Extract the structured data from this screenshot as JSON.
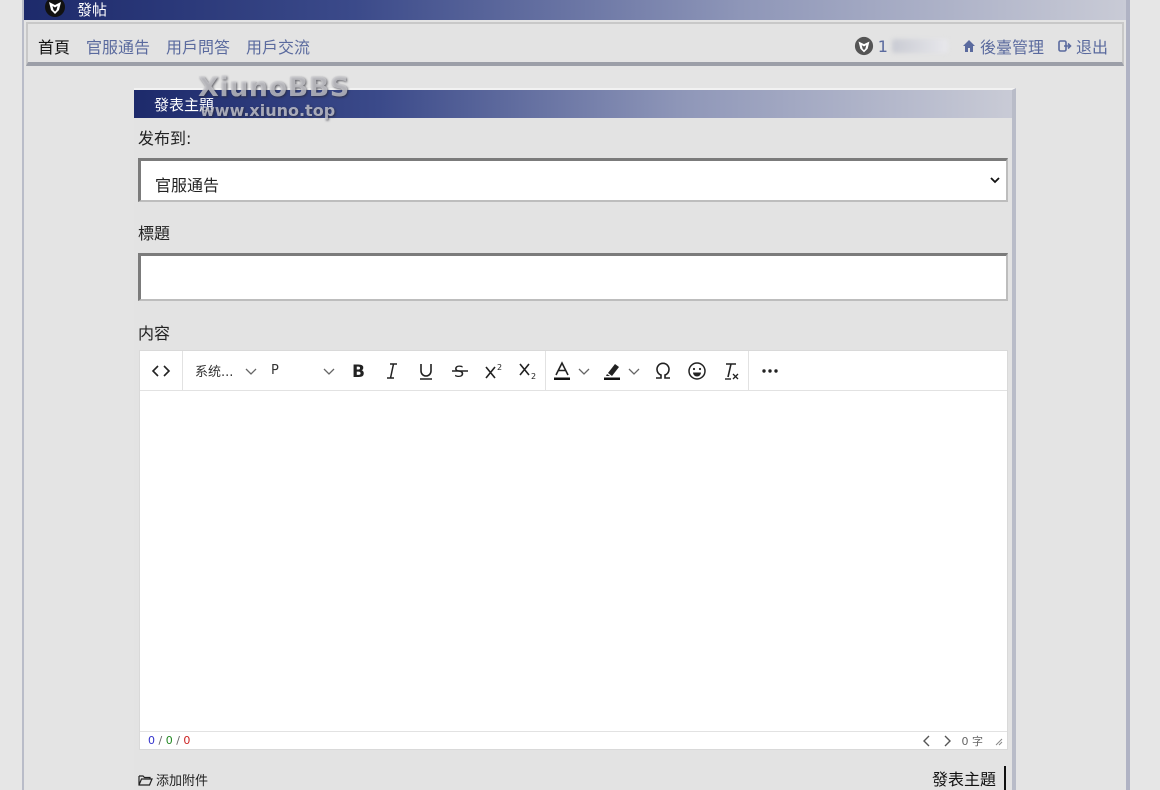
{
  "window": {
    "title": "發帖"
  },
  "nav": {
    "links": [
      "首頁",
      "官服通告",
      "用戶問答",
      "用戶交流"
    ],
    "user_label": "1",
    "admin_label": "後臺管理",
    "logout_label": "退出"
  },
  "panel": {
    "title": "發表主題",
    "watermark_line1": "XiunoBBS",
    "watermark_line2": "www.xiuno.top"
  },
  "form": {
    "publish_to_label": "发布到:",
    "publish_to_value": "官服通告",
    "title_label": "標題",
    "title_value": "",
    "content_label": "内容"
  },
  "editor": {
    "font_family": "系统...",
    "block_format": "P",
    "counts": {
      "a": "0",
      "b": "0",
      "c": "0"
    },
    "word_count": "0 字",
    "toolbar_icons": [
      "code-view-icon",
      "bold-icon",
      "italic-icon",
      "underline-icon",
      "strikethrough-icon",
      "superscript-icon",
      "subscript-icon",
      "font-color-icon",
      "highlight-icon",
      "special-char-icon",
      "emoji-icon",
      "clear-format-icon",
      "more-icon"
    ]
  },
  "attach": {
    "label": "添加附件"
  },
  "submit": {
    "label": "發表主題"
  }
}
